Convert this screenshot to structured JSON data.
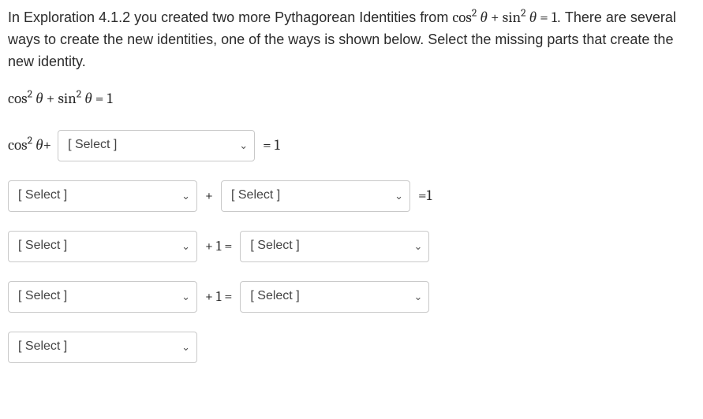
{
  "intro_part1": "In Exploration 4.1.2 you created two more Pythagorean Identities from ",
  "intro_math": "cos² θ + sin² θ = 1",
  "intro_part2": ". There are several ways to create the new identities, one of the ways is shown below.  Select the missing parts that create the new identity.",
  "base_identity": "cos² θ + sin² θ = 1",
  "row1": {
    "lead": "cos² θ+",
    "select": "[ Select ]",
    "after": "= 1"
  },
  "row2": {
    "selectA": "[ Select ]",
    "mid": "+",
    "selectB": "[ Select ]",
    "after": "=1"
  },
  "row3": {
    "selectA": "[ Select ]",
    "mid": "+ 1 =",
    "selectB": "[ Select ]"
  },
  "row4": {
    "selectA": "[ Select ]",
    "mid": "+ 1 =",
    "selectB": "[ Select ]"
  },
  "row5": {
    "selectA": "[ Select ]"
  }
}
